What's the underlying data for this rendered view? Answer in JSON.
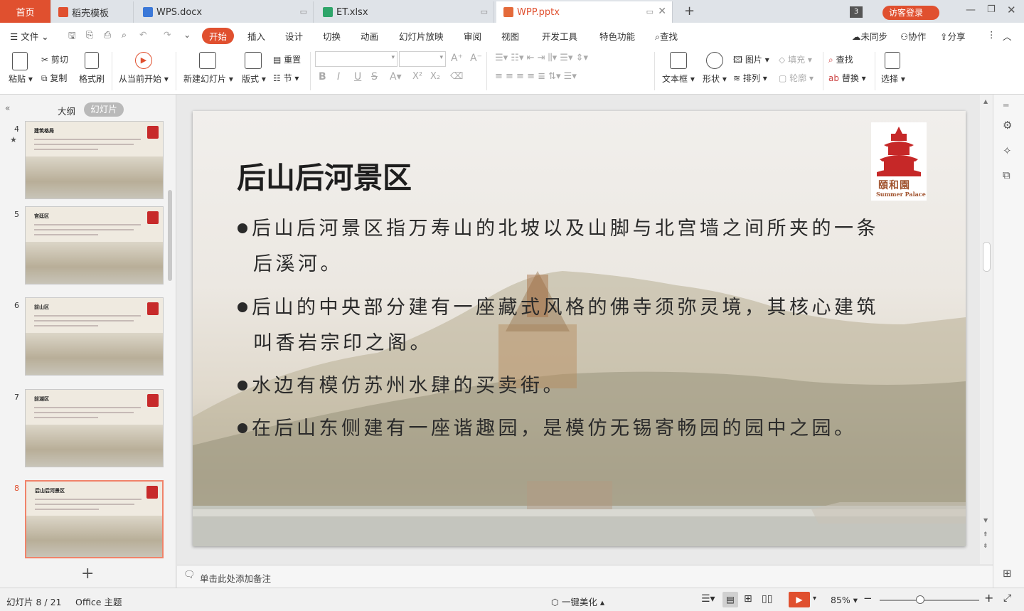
{
  "tabs": {
    "home": "首页",
    "docer": "稻壳模板",
    "wps_doc": "WPS.docx",
    "et_xlsx": "ET.xlsx",
    "wpp_pptx": "WPP.pptx",
    "badge_count": "3",
    "login": "访客登录"
  },
  "menu": {
    "file": "文件",
    "start": "开始",
    "insert": "插入",
    "design": "设计",
    "transition": "切换",
    "animation": "动画",
    "slideshow": "幻灯片放映",
    "review": "审阅",
    "view": "视图",
    "devtools": "开发工具",
    "special": "特色功能",
    "search": "查找",
    "sync": "未同步",
    "collab": "协作",
    "share": "分享"
  },
  "ribbon": {
    "paste": "粘贴",
    "cut": "剪切",
    "copy": "复制",
    "format_painter": "格式刷",
    "from_current": "从当前开始",
    "new_slide": "新建幻灯片",
    "layout": "版式",
    "reset": "重置",
    "section": "节",
    "textbox": "文本框",
    "shape": "形状",
    "picture": "图片",
    "fill": "填充",
    "arrange": "排列",
    "outline": "轮廓",
    "find": "查找",
    "replace": "替换",
    "select": "选择"
  },
  "panel": {
    "outline_tab": "大纲",
    "slides_tab": "幻灯片",
    "thumbnails": [
      {
        "num": "4",
        "title": "建筑格局"
      },
      {
        "num": "5",
        "title": "宫廷区"
      },
      {
        "num": "6",
        "title": "前山区"
      },
      {
        "num": "7",
        "title": "前湖区"
      },
      {
        "num": "8",
        "title": "后山后河景区"
      }
    ]
  },
  "slide": {
    "title": "后山后河景区",
    "logo_text_cn": "頤和園",
    "logo_text_en": "Summer Palace",
    "bullets": [
      {
        "line1": "后山后河景区指万寿山的北坡以及山脚与北宫墙之间所夹的一条",
        "line2": "后溪河。"
      },
      {
        "line1": "后山的中央部分建有一座藏式风格的佛寺须弥灵境，其核心建筑",
        "line2": "叫香岩宗印之阁。"
      },
      {
        "line1": "水边有模仿苏州水肆的买卖街。",
        "line2": ""
      },
      {
        "line1": "在后山东侧建有一座谐趣园，是模仿无锡寄畅园的园中之园。",
        "line2": ""
      }
    ]
  },
  "notes": {
    "placeholder": "单击此处添加备注"
  },
  "status": {
    "slide_info": "幻灯片 8 / 21",
    "theme": "Office 主题",
    "beautify": "一键美化",
    "zoom": "85%"
  },
  "colors": {
    "accent": "#e0502f",
    "selected_border": "#f0836a"
  }
}
